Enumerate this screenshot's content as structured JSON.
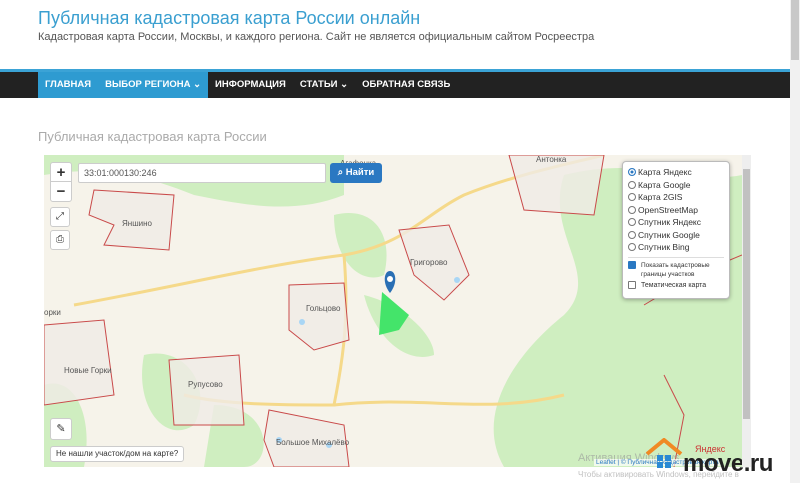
{
  "header": {
    "title": "Публичная кадастровая карта России онлайн",
    "description": "Кадастровая карта России, Москвы, и каждого региона. Сайт не является официальным сайтом Росреестра"
  },
  "nav": {
    "items": [
      {
        "label": "ГЛАВНАЯ"
      },
      {
        "label": "ВЫБОР РЕГИОНА ⌄"
      },
      {
        "label": "ИНФОРМАЦИЯ"
      },
      {
        "label": "СТАТЬИ ⌄"
      },
      {
        "label": "ОБРАТНАЯ СВЯЗЬ"
      }
    ]
  },
  "page_heading": "Публичная кадастровая карта России",
  "map": {
    "zoom_in": "+",
    "zoom_out": "−",
    "search_value": "33:01:000130:246",
    "search_button": "Найти",
    "layers": [
      {
        "label": "Карта Яндекс",
        "selected": true
      },
      {
        "label": "Карта Google"
      },
      {
        "label": "Карта 2GIS"
      },
      {
        "label": "OpenStreetMap"
      },
      {
        "label": "Спутник Яндекс"
      },
      {
        "label": "Спутник Google"
      },
      {
        "label": "Спутник Bing"
      }
    ],
    "options": [
      {
        "label": "Показать кадастровые границы участков",
        "checked": true
      },
      {
        "label": "Тематическая карта",
        "checked": false
      }
    ],
    "places": [
      "Агафонка",
      "Антонка",
      "Яншино",
      "Григорово",
      "Гольцово",
      "Новые Горки",
      "Рупусово",
      "Большое Михалёво",
      "орки"
    ],
    "not_found": "Не нашли участок/дом на карте?",
    "attribution": "Leaflet | © Публичная кадастровая карта",
    "yandex": "Яндекс"
  },
  "watermark": {
    "line1": "Активация Windows",
    "line2": "Чтобы активировать Windows, перейдите в",
    "brand": "move.ru"
  }
}
